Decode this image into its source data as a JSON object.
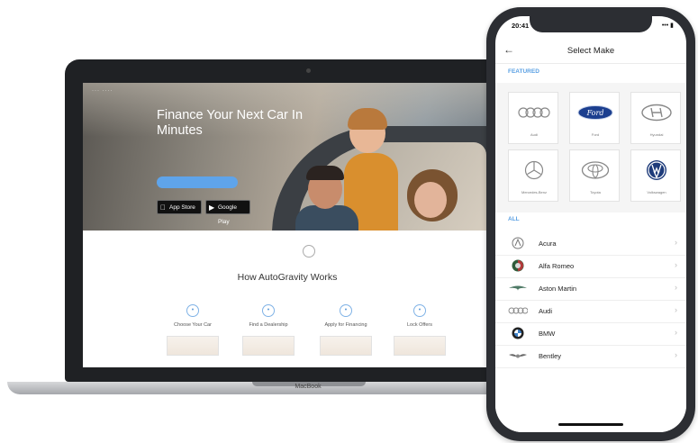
{
  "laptop": {
    "nav_text": "··· ····",
    "hero": {
      "title": "Finance Your Next Car In Minutes",
      "subtitle": "",
      "cta_label": "",
      "app_store_label": "App Store",
      "google_play_label": "Google Play"
    },
    "how_title": "How AutoGravity Works",
    "how_subtitle": "",
    "steps": [
      {
        "label": "Choose Your Car"
      },
      {
        "label": "Find a Dealership"
      },
      {
        "label": "Apply for Financing"
      },
      {
        "label": "Lock Offers"
      }
    ],
    "base_label": "MacBook"
  },
  "phone": {
    "time": "20:41",
    "status_right": "••• ▮",
    "header_title": "Select Make",
    "featured_label": "FEATURED",
    "all_label": "ALL",
    "featured_makes": [
      {
        "name": "Audi",
        "icon": "audi-logo-icon"
      },
      {
        "name": "Ford",
        "icon": "ford-logo-icon"
      },
      {
        "name": "Hyundai",
        "icon": "hyundai-logo-icon"
      },
      {
        "name": "Mercedes-Benz",
        "icon": "mercedes-logo-icon"
      },
      {
        "name": "Toyota",
        "icon": "toyota-logo-icon"
      },
      {
        "name": "Volkswagen",
        "icon": "volkswagen-logo-icon"
      }
    ],
    "all_makes": [
      {
        "name": "Acura",
        "icon": "acura-logo-icon"
      },
      {
        "name": "Alfa Romeo",
        "icon": "alfa-romeo-logo-icon"
      },
      {
        "name": "Aston Martin",
        "icon": "aston-martin-logo-icon"
      },
      {
        "name": "Audi",
        "icon": "audi-logo-icon"
      },
      {
        "name": "BMW",
        "icon": "bmw-logo-icon"
      },
      {
        "name": "Bentley",
        "icon": "bentley-logo-icon"
      }
    ],
    "accent_color": "#5aa0e3"
  }
}
